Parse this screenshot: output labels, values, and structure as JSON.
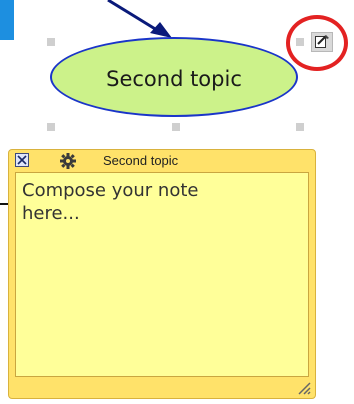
{
  "topic": {
    "label": "Second topic"
  },
  "note": {
    "title": "Second topic",
    "body_placeholder": "Compose your note\nhere...",
    "close_icon": "close-icon",
    "settings_icon": "gear-icon",
    "resize_icon": "resize-grip-icon"
  },
  "toolbar": {
    "edit_note_icon": "edit-note-icon"
  },
  "colors": {
    "topic_fill": "#ccf28a",
    "topic_border": "#1a35c9",
    "note_header": "#ffe26a",
    "note_body": "#ffff99",
    "highlight": "#e32222",
    "corner_accent": "#1d8fe0"
  }
}
